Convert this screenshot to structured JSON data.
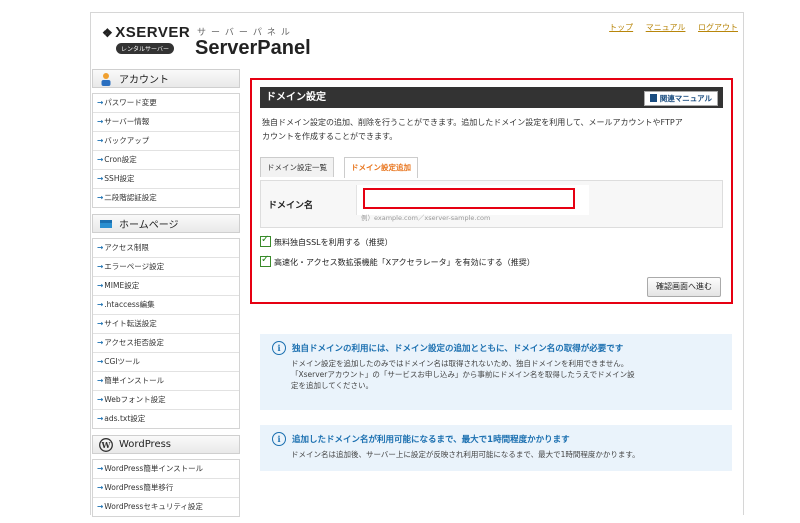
{
  "header": {
    "logo_text": "XSERVER",
    "logo_badge": "レンタルサーバー",
    "kana": "サーバーパネル",
    "brand": "ServerPanel",
    "links": [
      "トップ",
      "マニュアル",
      "ログアウト"
    ]
  },
  "sidebar": {
    "account": {
      "title": "アカウント",
      "items": [
        "パスワード変更",
        "サーバー情報",
        "バックアップ",
        "Cron設定",
        "SSH設定",
        "二段階認証設定"
      ]
    },
    "homepage": {
      "title": "ホームページ",
      "items": [
        "アクセス制限",
        "エラーページ設定",
        "MIME設定",
        ".htaccess編集",
        "サイト転送設定",
        "アクセス拒否設定",
        "CGIツール",
        "簡単インストール",
        "Webフォント設定",
        "ads.txt設定"
      ]
    },
    "wordpress": {
      "title": "WordPress",
      "items": [
        "WordPress簡単インストール",
        "WordPress簡単移行",
        "WordPressセキュリティ設定"
      ]
    }
  },
  "main": {
    "title": "ドメイン設定",
    "manual_button": "関連マニュアル",
    "description_line1": "独自ドメイン設定の追加、削除を行うことができます。追加したドメイン設定を利用して、メールアカウントやFTPア",
    "description_line2": "カウントを作成することができます。",
    "tabs": [
      "ドメイン設定一覧",
      "ドメイン設定追加"
    ],
    "active_tab": "ドメイン設定追加",
    "form": {
      "label": "ドメイン名",
      "value": "",
      "placeholder": "",
      "hint": "例）example.com／xserver-sample.com"
    },
    "checkboxes": [
      {
        "label": "無料独自SSLを利用する（推奨）",
        "checked": true
      },
      {
        "label": "高速化・アクセス数拡張機能「Xアクセラレータ」を有効にする（推奨）",
        "checked": true
      }
    ],
    "confirm_button": "確認画面へ進む"
  },
  "info": [
    {
      "heading": "独自ドメインの利用には、ドメイン設定の追加とともに、ドメイン名の取得が必要です",
      "lines": [
        "ドメイン設定を追加したのみではドメイン名は取得されないため、独自ドメインを利用できません。",
        "「Xserverアカウント」の「サービスお申し込み」から事前にドメイン名を取得したうえでドメイン設",
        "定を追加してください。"
      ]
    },
    {
      "heading": "追加したドメイン名が利用可能になるまで、最大で1時間程度かかります",
      "lines": [
        "ドメイン名は追加後、サーバー上に設定が反映され利用可能になるまで、最大で1時間程度かかります。"
      ]
    }
  ],
  "colors": {
    "accent_red": "#e60012",
    "link_blue": "#1a6fb0",
    "tab_orange": "#e8741c"
  }
}
